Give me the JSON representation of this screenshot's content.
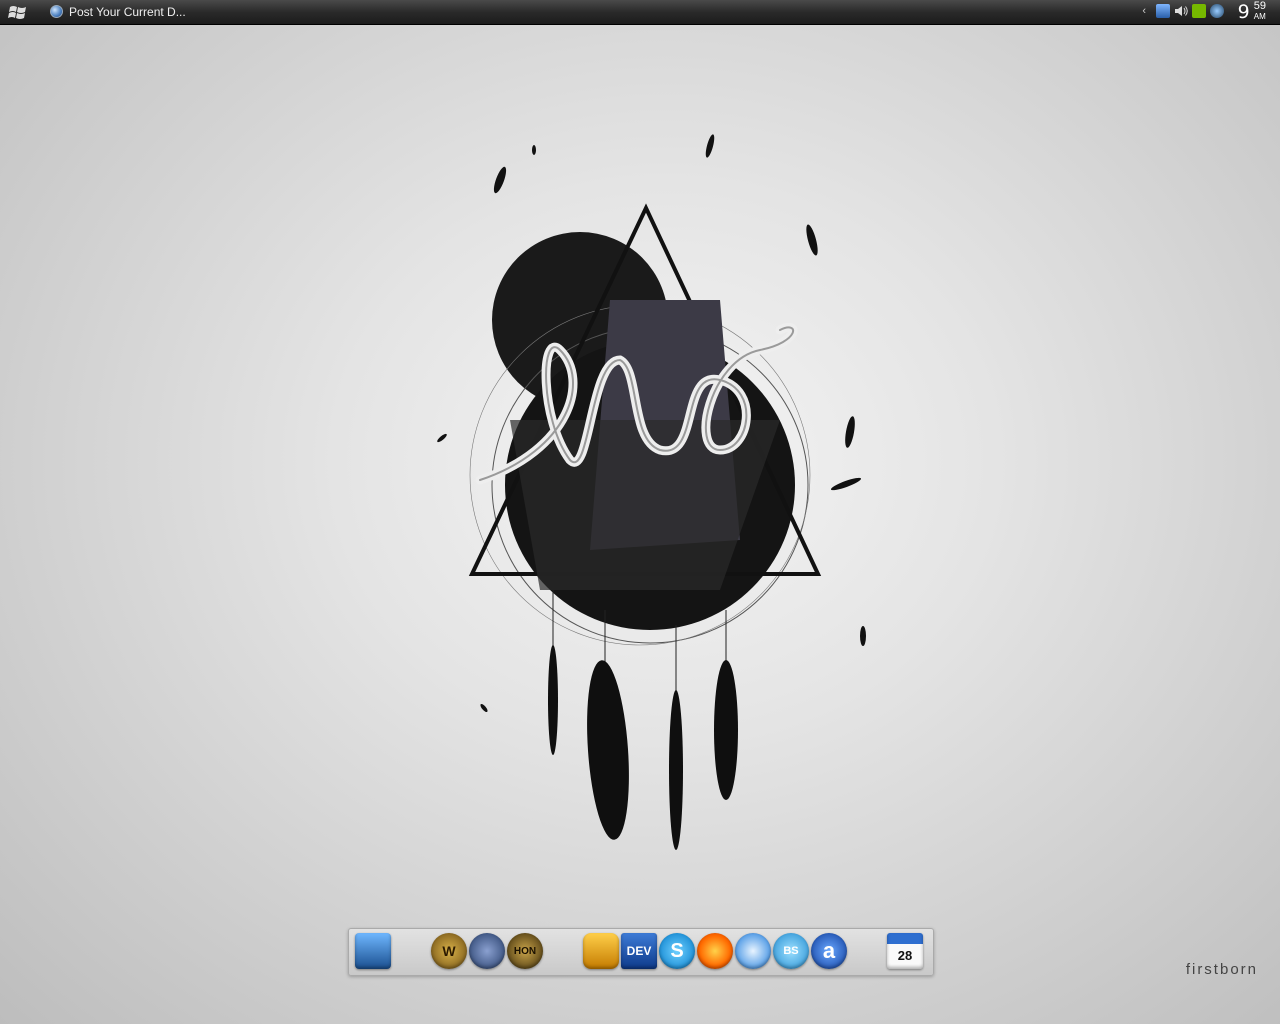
{
  "taskbar": {
    "window_title": "Post Your Current D...",
    "clock": {
      "hour": "9",
      "minute": "59",
      "ampm": "AM"
    },
    "tray_arrow": "‹"
  },
  "wallpaper": {
    "brand": "firstborn",
    "signature": "fwd"
  },
  "dock": {
    "items": [
      {
        "name": "desktop-monitor-icon",
        "label": ""
      },
      {
        "name": "world-of-warcraft-icon",
        "label": "W"
      },
      {
        "name": "counter-strike-icon",
        "label": ""
      },
      {
        "name": "heroes-of-newerth-icon",
        "label": "HON"
      },
      {
        "name": "winamp-icon",
        "label": ""
      },
      {
        "name": "dev-cpp-icon",
        "label": "DEV"
      },
      {
        "name": "skype-icon",
        "label": "S"
      },
      {
        "name": "firefox-icon",
        "label": ""
      },
      {
        "name": "safari-icon",
        "label": ""
      },
      {
        "name": "bs-player-icon",
        "label": "BS"
      },
      {
        "name": "aim-icon",
        "label": "a"
      },
      {
        "name": "calendar-icon",
        "label": "28"
      }
    ]
  },
  "colors": {
    "taskbar_bg": "#2a2a2a",
    "wallpaper_bg": "#e0e0e0",
    "dock_bg": "#d4d4d4"
  }
}
